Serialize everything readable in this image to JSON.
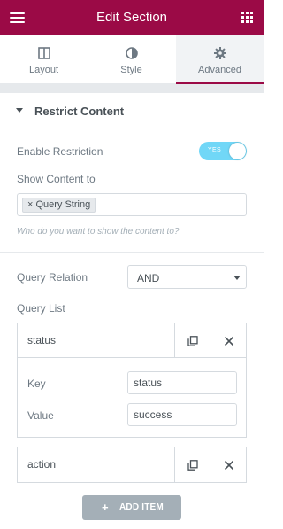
{
  "header": {
    "title": "Edit Section",
    "menu_icon": "hamburger-icon",
    "apps_icon": "grid-icon",
    "color": "#9b0a46"
  },
  "tabs": [
    {
      "label": "Layout",
      "icon": "layout-columns-icon"
    },
    {
      "label": "Style",
      "icon": "half-circle-icon"
    },
    {
      "label": "Advanced",
      "icon": "gear-icon",
      "active": true
    }
  ],
  "section": {
    "title": "Restrict Content",
    "enable_restriction": {
      "label": "Enable Restriction",
      "toggle_text": "YES",
      "on": true,
      "color": "#71d7f7"
    },
    "show_content_to": {
      "label": "Show Content to",
      "selected": [
        "Query String"
      ],
      "chip_remove": "×",
      "hint": "Who do you want to show the content to?"
    },
    "query_relation": {
      "label": "Query Relation",
      "value": "AND"
    },
    "query_list": {
      "label": "Query List",
      "items": [
        {
          "title": "status",
          "expanded": true,
          "key_label": "Key",
          "key": "status",
          "value_label": "Value",
          "value": "success"
        },
        {
          "title": "action",
          "expanded": false
        }
      ]
    },
    "add_item": {
      "plus": "+",
      "label": "ADD ITEM"
    }
  }
}
